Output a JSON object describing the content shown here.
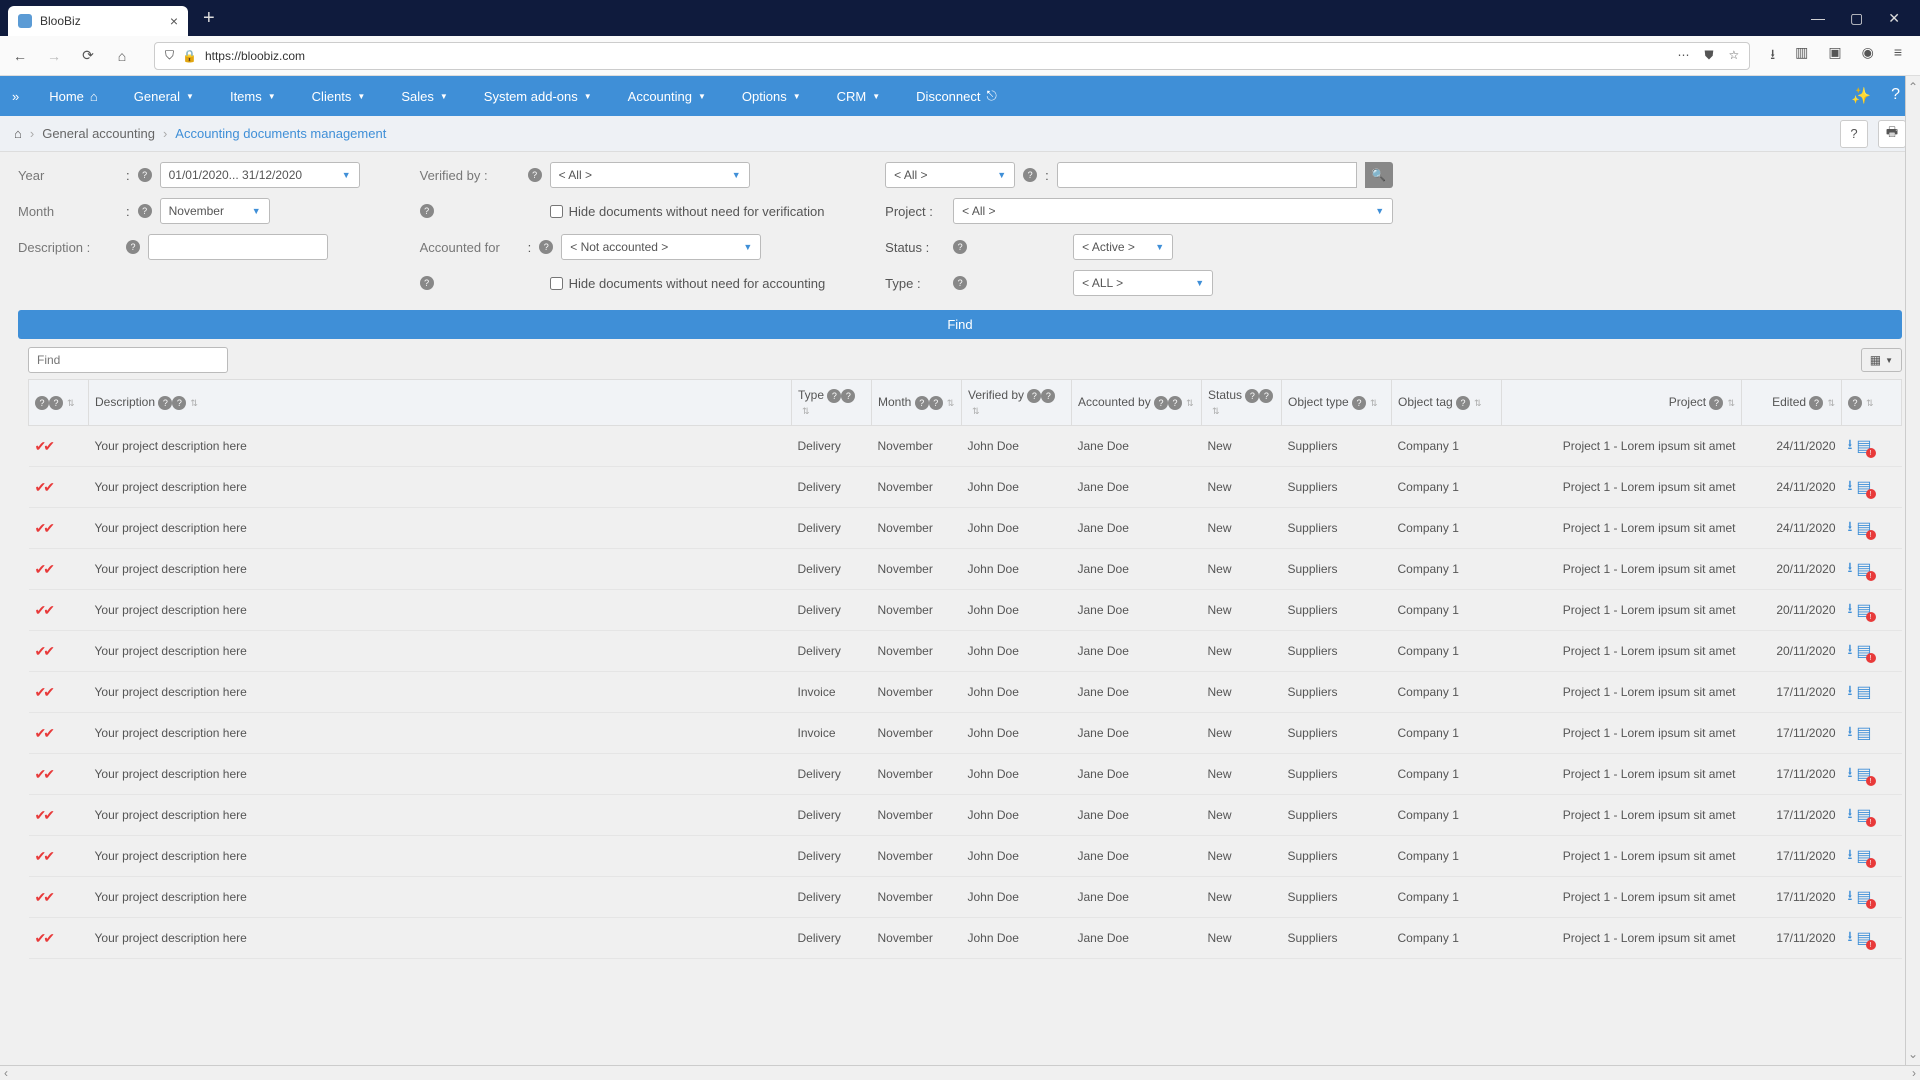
{
  "browser": {
    "tab_title": "BlooBiz",
    "url": "https://bloobiz.com"
  },
  "nav": {
    "items": [
      "Home",
      "General",
      "Items",
      "Clients",
      "Sales",
      "System add-ons",
      "Accounting",
      "Options",
      "CRM",
      "Disconnect"
    ]
  },
  "breadcrumb": {
    "level1": "General accounting",
    "level2": "Accounting documents management"
  },
  "filters": {
    "year_label": "Year",
    "year_value": "01/01/2020... 31/12/2020",
    "month_label": "Month",
    "month_value": "November",
    "description_label": "Description :",
    "verified_label": "Verified by :",
    "verified_value": "< All >",
    "hide_verif": "Hide documents without need for verification",
    "accounted_label": "Accounted for",
    "accounted_value": "< Not accounted >",
    "hide_acc": "Hide documents without need for accounting",
    "top_all": "< All >",
    "project_label": "Project :",
    "project_value": "< All >",
    "status_label": "Status :",
    "status_value": "< Active >",
    "type_label": "Type :",
    "type_value": "< ALL >",
    "find_btn": "Find",
    "find_placeholder": "Find"
  },
  "columns": [
    "",
    "Description",
    "Type",
    "Month",
    "Verified by",
    "Accounted by",
    "Status",
    "Object type",
    "Object tag",
    "Project",
    "Edited",
    ""
  ],
  "rows": [
    {
      "desc": "Your project description here",
      "type": "Delivery",
      "month": "November",
      "verified": "John Doe",
      "accounted": "Jane Doe",
      "status": "New",
      "objtype": "Suppliers",
      "objtag": "Company 1",
      "project": "Project 1 - Lorem ipsum sit amet",
      "edited": "24/11/2020",
      "badge": true
    },
    {
      "desc": "Your project description here",
      "type": "Delivery",
      "month": "November",
      "verified": "John Doe",
      "accounted": "Jane Doe",
      "status": "New",
      "objtype": "Suppliers",
      "objtag": "Company 1",
      "project": "Project 1 - Lorem ipsum sit amet",
      "edited": "24/11/2020",
      "badge": true
    },
    {
      "desc": "Your project description here",
      "type": "Delivery",
      "month": "November",
      "verified": "John Doe",
      "accounted": "Jane Doe",
      "status": "New",
      "objtype": "Suppliers",
      "objtag": "Company 1",
      "project": "Project 1 - Lorem ipsum sit amet",
      "edited": "24/11/2020",
      "badge": true
    },
    {
      "desc": "Your project description here",
      "type": "Delivery",
      "month": "November",
      "verified": "John Doe",
      "accounted": "Jane Doe",
      "status": "New",
      "objtype": "Suppliers",
      "objtag": "Company 1",
      "project": "Project 1 - Lorem ipsum sit amet",
      "edited": "20/11/2020",
      "badge": true
    },
    {
      "desc": "Your project description here",
      "type": "Delivery",
      "month": "November",
      "verified": "John Doe",
      "accounted": "Jane Doe",
      "status": "New",
      "objtype": "Suppliers",
      "objtag": "Company 1",
      "project": "Project 1 - Lorem ipsum sit amet",
      "edited": "20/11/2020",
      "badge": true
    },
    {
      "desc": "Your project description here",
      "type": "Delivery",
      "month": "November",
      "verified": "John Doe",
      "accounted": "Jane Doe",
      "status": "New",
      "objtype": "Suppliers",
      "objtag": "Company 1",
      "project": "Project 1 - Lorem ipsum sit amet",
      "edited": "20/11/2020",
      "badge": true
    },
    {
      "desc": "Your project description here",
      "type": "Invoice",
      "month": "November",
      "verified": "John Doe",
      "accounted": "Jane Doe",
      "status": "New",
      "objtype": "Suppliers",
      "objtag": "Company 1",
      "project": "Project 1 - Lorem ipsum sit amet",
      "edited": "17/11/2020",
      "badge": false
    },
    {
      "desc": "Your project description here",
      "type": "Invoice",
      "month": "November",
      "verified": "John Doe",
      "accounted": "Jane Doe",
      "status": "New",
      "objtype": "Suppliers",
      "objtag": "Company 1",
      "project": "Project 1 - Lorem ipsum sit amet",
      "edited": "17/11/2020",
      "badge": false
    },
    {
      "desc": "Your project description here",
      "type": "Delivery",
      "month": "November",
      "verified": "John Doe",
      "accounted": "Jane Doe",
      "status": "New",
      "objtype": "Suppliers",
      "objtag": "Company 1",
      "project": "Project 1 - Lorem ipsum sit amet",
      "edited": "17/11/2020",
      "badge": true
    },
    {
      "desc": "Your project description here",
      "type": "Delivery",
      "month": "November",
      "verified": "John Doe",
      "accounted": "Jane Doe",
      "status": "New",
      "objtype": "Suppliers",
      "objtag": "Company 1",
      "project": "Project 1 - Lorem ipsum sit amet",
      "edited": "17/11/2020",
      "badge": true
    },
    {
      "desc": "Your project description here",
      "type": "Delivery",
      "month": "November",
      "verified": "John Doe",
      "accounted": "Jane Doe",
      "status": "New",
      "objtype": "Suppliers",
      "objtag": "Company 1",
      "project": "Project 1 - Lorem ipsum sit amet",
      "edited": "17/11/2020",
      "badge": true
    },
    {
      "desc": "Your project description here",
      "type": "Delivery",
      "month": "November",
      "verified": "John Doe",
      "accounted": "Jane Doe",
      "status": "New",
      "objtype": "Suppliers",
      "objtag": "Company 1",
      "project": "Project 1 - Lorem ipsum sit amet",
      "edited": "17/11/2020",
      "badge": true
    },
    {
      "desc": "Your project description here",
      "type": "Delivery",
      "month": "November",
      "verified": "John Doe",
      "accounted": "Jane Doe",
      "status": "New",
      "objtype": "Suppliers",
      "objtag": "Company 1",
      "project": "Project 1 - Lorem ipsum sit amet",
      "edited": "17/11/2020",
      "badge": true
    }
  ]
}
